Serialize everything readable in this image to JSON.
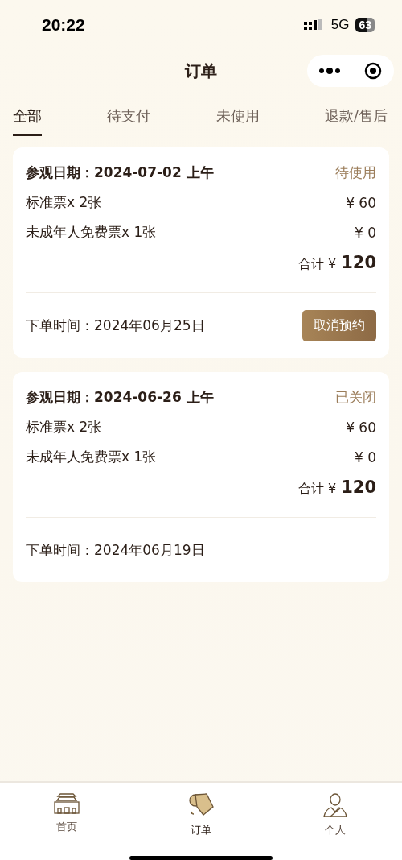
{
  "status_bar": {
    "time": "20:22",
    "network": "5G",
    "battery": "63"
  },
  "nav": {
    "title": "订单"
  },
  "tabs": [
    {
      "label": "全部",
      "selected": true
    },
    {
      "label": "待支付",
      "selected": false
    },
    {
      "label": "未使用",
      "selected": false
    },
    {
      "label": "退款/售后",
      "selected": false
    }
  ],
  "orders": [
    {
      "visit_date": "参观日期：2024-07-02 上午",
      "status": "待使用",
      "items": [
        {
          "name": "标准票x 2张",
          "price": "¥ 60"
        },
        {
          "name": "未成年人免费票x 1张",
          "price": "¥ 0"
        }
      ],
      "total_label": "合计 ¥",
      "total": "120",
      "order_time": "下单时间：2024年06月25日",
      "action": "取消预约"
    },
    {
      "visit_date": "参观日期：2024-06-26 上午",
      "status": "已关闭",
      "items": [
        {
          "name": "标准票x 2张",
          "price": "¥ 60"
        },
        {
          "name": "未成年人免费票x 1张",
          "price": "¥ 0"
        }
      ],
      "total_label": "合计 ¥",
      "total": "120",
      "order_time": "下单时间：2024年06月19日"
    }
  ],
  "bottom_nav": [
    {
      "kind": "home",
      "label": "首页",
      "selected": false
    },
    {
      "kind": "orders",
      "label": "订单",
      "selected": true
    },
    {
      "kind": "profile",
      "label": "个人",
      "selected": false
    }
  ]
}
